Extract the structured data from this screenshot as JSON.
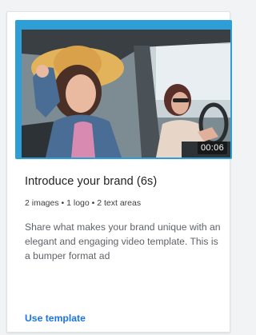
{
  "card": {
    "duration": "00:06",
    "title": "Introduce your brand (6s)",
    "meta": "2 images • 1 logo • 2 text areas",
    "description": "Share what makes your brand unique with an elegant and engaging video template. This is a bumper format ad",
    "action_label": "Use template"
  },
  "colors": {
    "frame_accent": "#2d9fd6",
    "link": "#1a73e8"
  }
}
